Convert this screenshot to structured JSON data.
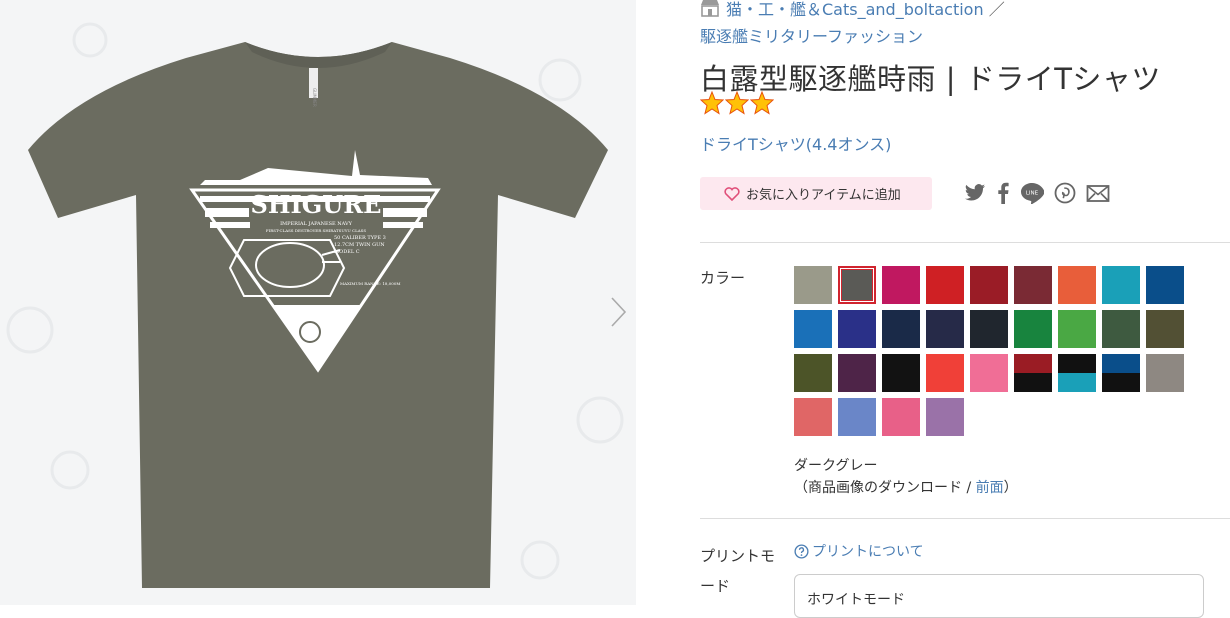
{
  "breadcrumb": {
    "shop_icon": "shop-icon",
    "shop": "猫・工・艦＆Cats_and_boltaction",
    "sep": "／",
    "category": "駆逐艦ミリタリーファッション"
  },
  "product": {
    "title": "白露型駆逐艦時雨 | ドライTシャツ",
    "rating_stars": 3,
    "type": "ドライTシャツ(4.4オンス)"
  },
  "favorite": {
    "label": "お気に入りアイテムに追加",
    "icon": "heart-icon"
  },
  "share_icons": [
    "twitter-icon",
    "facebook-icon",
    "line-icon",
    "pinterest-icon",
    "mail-icon"
  ],
  "share_line_text": "LINE",
  "color": {
    "label": "カラー",
    "selected_index": 1,
    "selected_name": "ダークグレー",
    "download_prefix": "（商品画像のダウンロード / ",
    "download_link": "前面",
    "download_suffix": "）",
    "swatches": [
      [
        "#9a9a8a"
      ],
      [
        "#5a5a56"
      ],
      [
        "#c01860"
      ],
      [
        "#cf2024"
      ],
      [
        "#9a1c26"
      ],
      [
        "#7a2a34"
      ],
      [
        "#e85e3a"
      ],
      [
        "#1aa0b8"
      ],
      [
        "#0a4e8a"
      ],
      [
        "#1a70b8"
      ],
      [
        "#2a3088"
      ],
      [
        "#1a2a48"
      ],
      [
        "#262a48"
      ],
      [
        "#20262e"
      ],
      [
        "#18843e"
      ],
      [
        "#4aa844"
      ],
      [
        "#3e5a40"
      ],
      [
        "#525034"
      ],
      [
        "#4c5428"
      ],
      [
        "#4e2448"
      ],
      [
        "#121212"
      ],
      [
        "#f04038"
      ],
      [
        "#f06e96"
      ],
      [
        "#9a1c24",
        "#111111"
      ],
      [
        "#111111",
        "#1aa0b8"
      ],
      [
        "#0a4e8a",
        "#111111"
      ],
      [
        "#8e8882"
      ],
      [
        "#e06666"
      ],
      [
        "#6a86c8"
      ],
      [
        "#e86088"
      ],
      [
        "#9a72a8"
      ]
    ]
  },
  "print": {
    "label": "プリントモード",
    "help_link": "プリントについて",
    "help_icon": "question-circle-icon",
    "mode_value": "ホワイトモード"
  },
  "shirt": {
    "brand_tag": "GLIMMER",
    "name_text": "SHIGURE",
    "sub1": "IMPERIAL JAPANESE NAVY",
    "sub2": "FIRST-CLASS DESTROYER SHIRATSUYU CLASS",
    "gun1": "50 CALIBER TYPE 3",
    "gun2": "12.7CM TWIN GUN",
    "gun3": "MODEL C",
    "range": "MAXIMUM RANGE: 18,000M"
  },
  "colors": {
    "accent_link": "#4a7db3",
    "shirt": "#6b6c60",
    "fav_bg": "#fde8ef",
    "select_red": "#d0242e"
  }
}
